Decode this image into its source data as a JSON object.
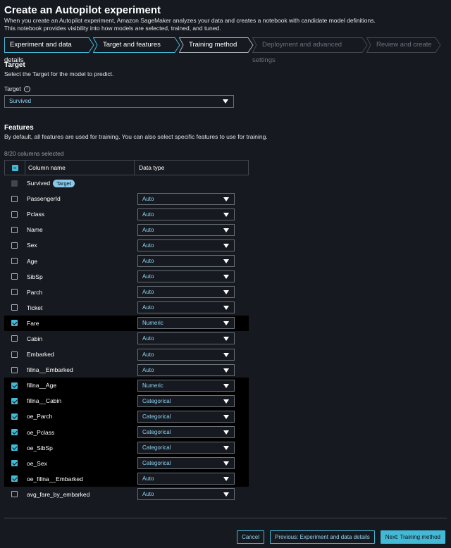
{
  "header": {
    "title": "Create an Autopilot experiment",
    "description_line1": "When you create an Autopilot experiment, Amazon SageMaker analyzes your data and creates a notebook with candidate model definitions.",
    "description_line2": "This notebook provides visibility into how models are selected, trained, and tuned."
  },
  "steps": [
    {
      "label": "Experiment and data details",
      "state": "done"
    },
    {
      "label": "Target and features",
      "state": "done"
    },
    {
      "label": "Training method",
      "state": "current"
    },
    {
      "label": "Deployment and advanced settings",
      "state": "future"
    },
    {
      "label": "Review and create",
      "state": "future"
    }
  ],
  "target": {
    "section_title": "Target",
    "section_desc": "Select the Target for the model to predict.",
    "field_label": "Target",
    "info_icon": "i",
    "selected": "Survived"
  },
  "features": {
    "section_title": "Features",
    "section_desc": "By default, all features are used for training. You can also select specific features to use for training.",
    "count_text": "8/20 columns selected",
    "col_name_header": "Column name",
    "col_type_header": "Data type",
    "target_badge": "Target",
    "rows": [
      {
        "name": "Survived",
        "type": null,
        "checked": false,
        "is_target": true
      },
      {
        "name": "PassengerId",
        "type": "Auto",
        "checked": false
      },
      {
        "name": "Pclass",
        "type": "Auto",
        "checked": false
      },
      {
        "name": "Name",
        "type": "Auto",
        "checked": false
      },
      {
        "name": "Sex",
        "type": "Auto",
        "checked": false
      },
      {
        "name": "Age",
        "type": "Auto",
        "checked": false
      },
      {
        "name": "SibSp",
        "type": "Auto",
        "checked": false
      },
      {
        "name": "Parch",
        "type": "Auto",
        "checked": false
      },
      {
        "name": "Ticket",
        "type": "Auto",
        "checked": false
      },
      {
        "name": "Fare",
        "type": "Numeric",
        "checked": true
      },
      {
        "name": "Cabin",
        "type": "Auto",
        "checked": false
      },
      {
        "name": "Embarked",
        "type": "Auto",
        "checked": false
      },
      {
        "name": "fillna__Embarked",
        "type": "Auto",
        "checked": false
      },
      {
        "name": "fillna__Age",
        "type": "Numeric",
        "checked": true
      },
      {
        "name": "fillna__Cabin",
        "type": "Categorical",
        "checked": true
      },
      {
        "name": "oe_Parch",
        "type": "Categorical",
        "checked": true
      },
      {
        "name": "oe_Pclass",
        "type": "Categorical",
        "checked": true
      },
      {
        "name": "oe_SibSp",
        "type": "Categorical",
        "checked": true
      },
      {
        "name": "oe_Sex",
        "type": "Categorical",
        "checked": true
      },
      {
        "name": "oe_fillna__Embarked",
        "type": "Auto",
        "checked": true
      },
      {
        "name": "avg_fare_by_embarked",
        "type": "Auto",
        "checked": false
      }
    ]
  },
  "footer": {
    "cancel": "Cancel",
    "previous": "Previous: Experiment and data details",
    "next": "Next: Training method"
  },
  "colors": {
    "accent": "#44b9d6",
    "background": "#16191f",
    "selected_row": "#000000"
  }
}
